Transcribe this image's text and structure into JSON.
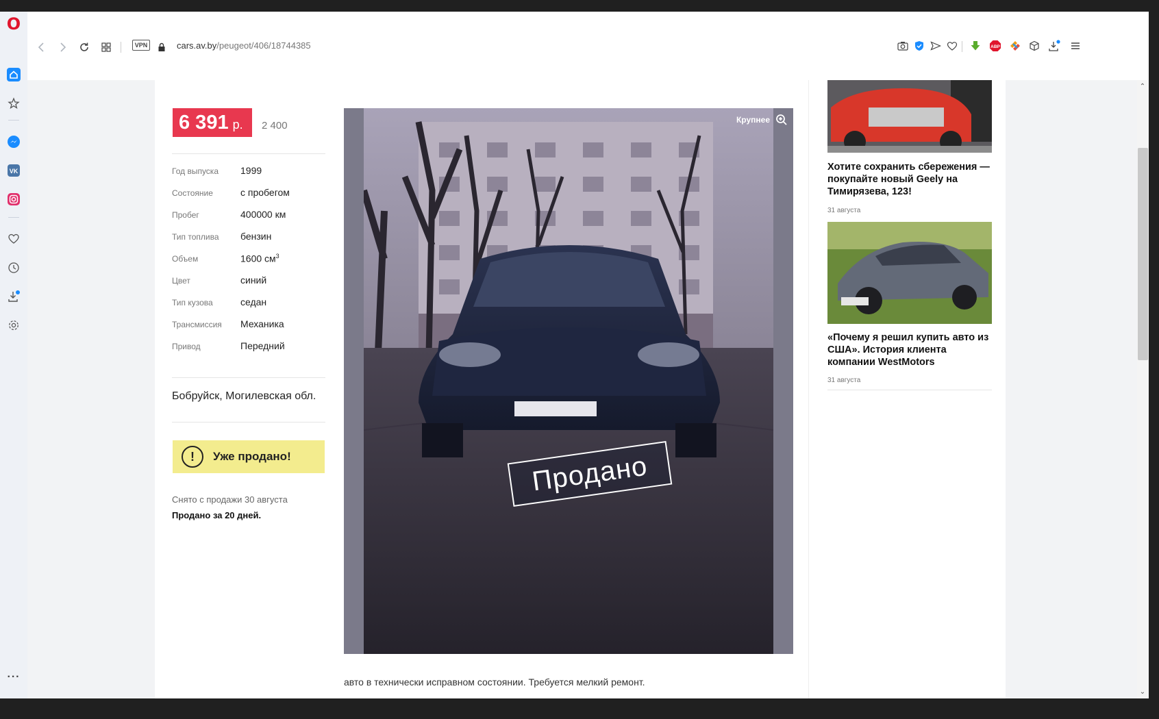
{
  "browser": {
    "url_host": "cars.av.by",
    "url_path": "/peugeot/406/18744385",
    "vpn_label": "VPN"
  },
  "listing": {
    "price_byn": "6 391",
    "price_currency": "р.",
    "price_usd": "2 400",
    "specs": [
      {
        "label": "Год выпуска",
        "value": "1999"
      },
      {
        "label": "Состояние",
        "value": "с пробегом"
      },
      {
        "label": "Пробег",
        "value": "400000 км"
      },
      {
        "label": "Тип топлива",
        "value": "бензин"
      },
      {
        "label": "Объем",
        "value": "1600 см",
        "sup": "3"
      },
      {
        "label": "Цвет",
        "value": "синий"
      },
      {
        "label": "Тип кузова",
        "value": "седан"
      },
      {
        "label": "Трансмиссия",
        "value": "Механика"
      },
      {
        "label": "Привод",
        "value": "Передний"
      }
    ],
    "location": "Бобруйск, Могилевская обл.",
    "sold_label": "Уже продано!",
    "removed_text": "Снято с продажи 30 августа",
    "sold_days_text": "Продано за 20 дней.",
    "photo_zoom_label": "Крупнее",
    "photo_stamp": "Продано",
    "description": "авто в технически исправном состоянии. Требуется мелкий ремонт."
  },
  "news": [
    {
      "title": "Хотите сохранить сбережения — покупайте новый Geely на Тимирязева, 123!",
      "date": "31 августа"
    },
    {
      "title": "«Почему я решил купить авто из США». История клиента компании WestMotors",
      "date": "31 августа"
    }
  ],
  "colors": {
    "price_bg": "#e8384f",
    "sold_bg": "#f3ec8e",
    "opera_red": "#e0152d",
    "sidebar_accent": "#1a8cff"
  },
  "icons": [
    "opera-logo-icon",
    "home-icon",
    "star-icon",
    "messenger-icon",
    "vk-icon",
    "instagram-icon",
    "heart-icon",
    "history-icon",
    "downloads-icon",
    "settings-icon",
    "more-icon",
    "back-icon",
    "forward-icon",
    "reload-icon",
    "tabs-grid-icon",
    "lock-icon",
    "camera-icon",
    "shield-icon",
    "send-icon",
    "heart-icon",
    "download-arrow-icon",
    "adblock-icon",
    "extension-icon",
    "box-icon",
    "download-icon",
    "menu-icon",
    "zoom-icon",
    "exclamation-icon"
  ]
}
